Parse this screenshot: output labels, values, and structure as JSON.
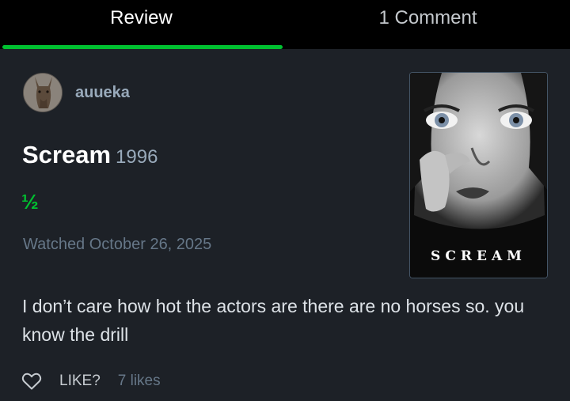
{
  "tabs": {
    "review_label": "Review",
    "comments_label": "1 Comment"
  },
  "review": {
    "author": "auueka",
    "film_title": "Scream",
    "film_year": "1996",
    "rating": "½",
    "watched": "Watched October 26, 2025",
    "text": "I don’t care how hot the actors are there are no horses so. you know the drill"
  },
  "poster": {
    "wordmark": "SCREAM"
  },
  "actions": {
    "like_label": "LIKE?",
    "likes_count": "7 likes",
    "heart_icon": "heart-outline-icon"
  },
  "colors": {
    "background": "#1d2127",
    "tab_bar": "#000000",
    "accent_green": "#00c030",
    "muted_text": "#667788",
    "author_text": "#99aabb"
  }
}
